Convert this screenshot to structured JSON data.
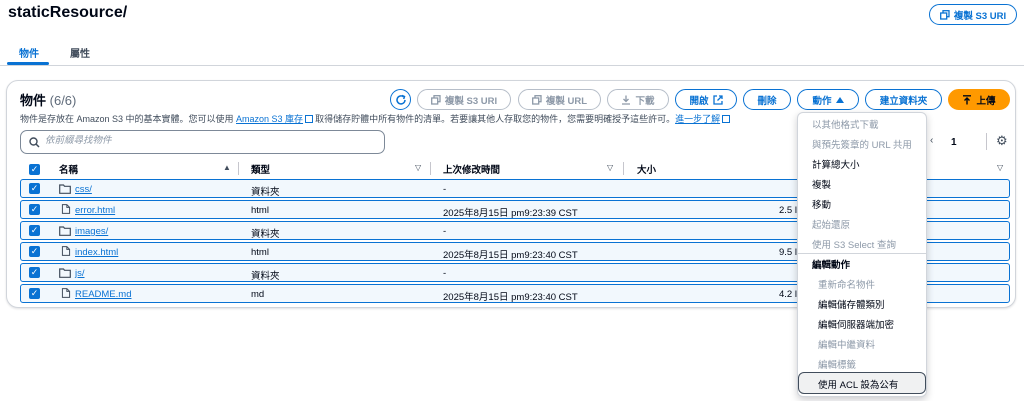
{
  "header": {
    "title": "staticResource/",
    "copy_s3_uri_label": "複製 S3 URI"
  },
  "tabs": [
    {
      "label": "物件",
      "active": true
    },
    {
      "label": "屬性",
      "active": false
    }
  ],
  "objects_panel": {
    "title": "物件",
    "count": "(6/6)",
    "description": {
      "text_before": "物件是存放在 Amazon S3 中的基本實體。您可以使用 ",
      "link1": "Amazon S3 庫存",
      "text_middle": "取得儲存貯體中所有物件的清單。若要讓其他人存取您的物件，您需要明確授予這些許可。",
      "link2": "進一步了解"
    },
    "search_placeholder": "依前綴尋找物件",
    "toolbar": {
      "copy_s3_uri": "複製 S3 URI",
      "copy_url": "複製 URL",
      "download": "下載",
      "open": "開啟",
      "delete": "刪除",
      "actions": "動作",
      "create_folder": "建立資料夾",
      "upload": "上傳"
    },
    "pagination": {
      "current_page": "1"
    },
    "columns": [
      "名稱",
      "類型",
      "上次修改時間",
      "大小"
    ],
    "rows": [
      {
        "name": "css/",
        "type": "資料夾",
        "modified": "-",
        "size": "",
        "icon": "folder-icon"
      },
      {
        "name": "error.html",
        "type": "html",
        "modified": "2025年8月15日 pm9:23:39 CST",
        "size": "2.5 l",
        "icon": "file-icon"
      },
      {
        "name": "images/",
        "type": "資料夾",
        "modified": "-",
        "size": "",
        "icon": "folder-icon"
      },
      {
        "name": "index.html",
        "type": "html",
        "modified": "2025年8月15日 pm9:23:40 CST",
        "size": "9.5 l",
        "icon": "file-icon"
      },
      {
        "name": "js/",
        "type": "資料夾",
        "modified": "-",
        "size": "",
        "icon": "folder-icon"
      },
      {
        "name": "README.md",
        "type": "md",
        "modified": "2025年8月15日 pm9:23:40 CST",
        "size": "4.2 l",
        "icon": "file-icon"
      }
    ]
  },
  "actions_menu": {
    "items": [
      {
        "label": "以其他格式下載",
        "enabled": false
      },
      {
        "label": "與預先簽章的 URL 共用",
        "enabled": false
      },
      {
        "label": "計算總大小",
        "enabled": true
      },
      {
        "label": "複製",
        "enabled": true
      },
      {
        "label": "移動",
        "enabled": true
      },
      {
        "label": "起始還原",
        "enabled": false
      },
      {
        "label": "使用 S3 Select 查詢",
        "enabled": false
      }
    ],
    "group_label": "編輯動作",
    "group_items": [
      {
        "label": "重新命名物件",
        "enabled": false
      },
      {
        "label": "編輯儲存體類別",
        "enabled": true
      },
      {
        "label": "編輯伺服器端加密",
        "enabled": true
      },
      {
        "label": "編輯中繼資料",
        "enabled": false
      },
      {
        "label": "編輯標籤",
        "enabled": false
      },
      {
        "label": "使用 ACL 設為公有",
        "enabled": true,
        "highlighted": true
      }
    ]
  },
  "colors": {
    "accent": "#0972d3",
    "primary": "#ff9900",
    "disabled": "#8d99a8"
  }
}
